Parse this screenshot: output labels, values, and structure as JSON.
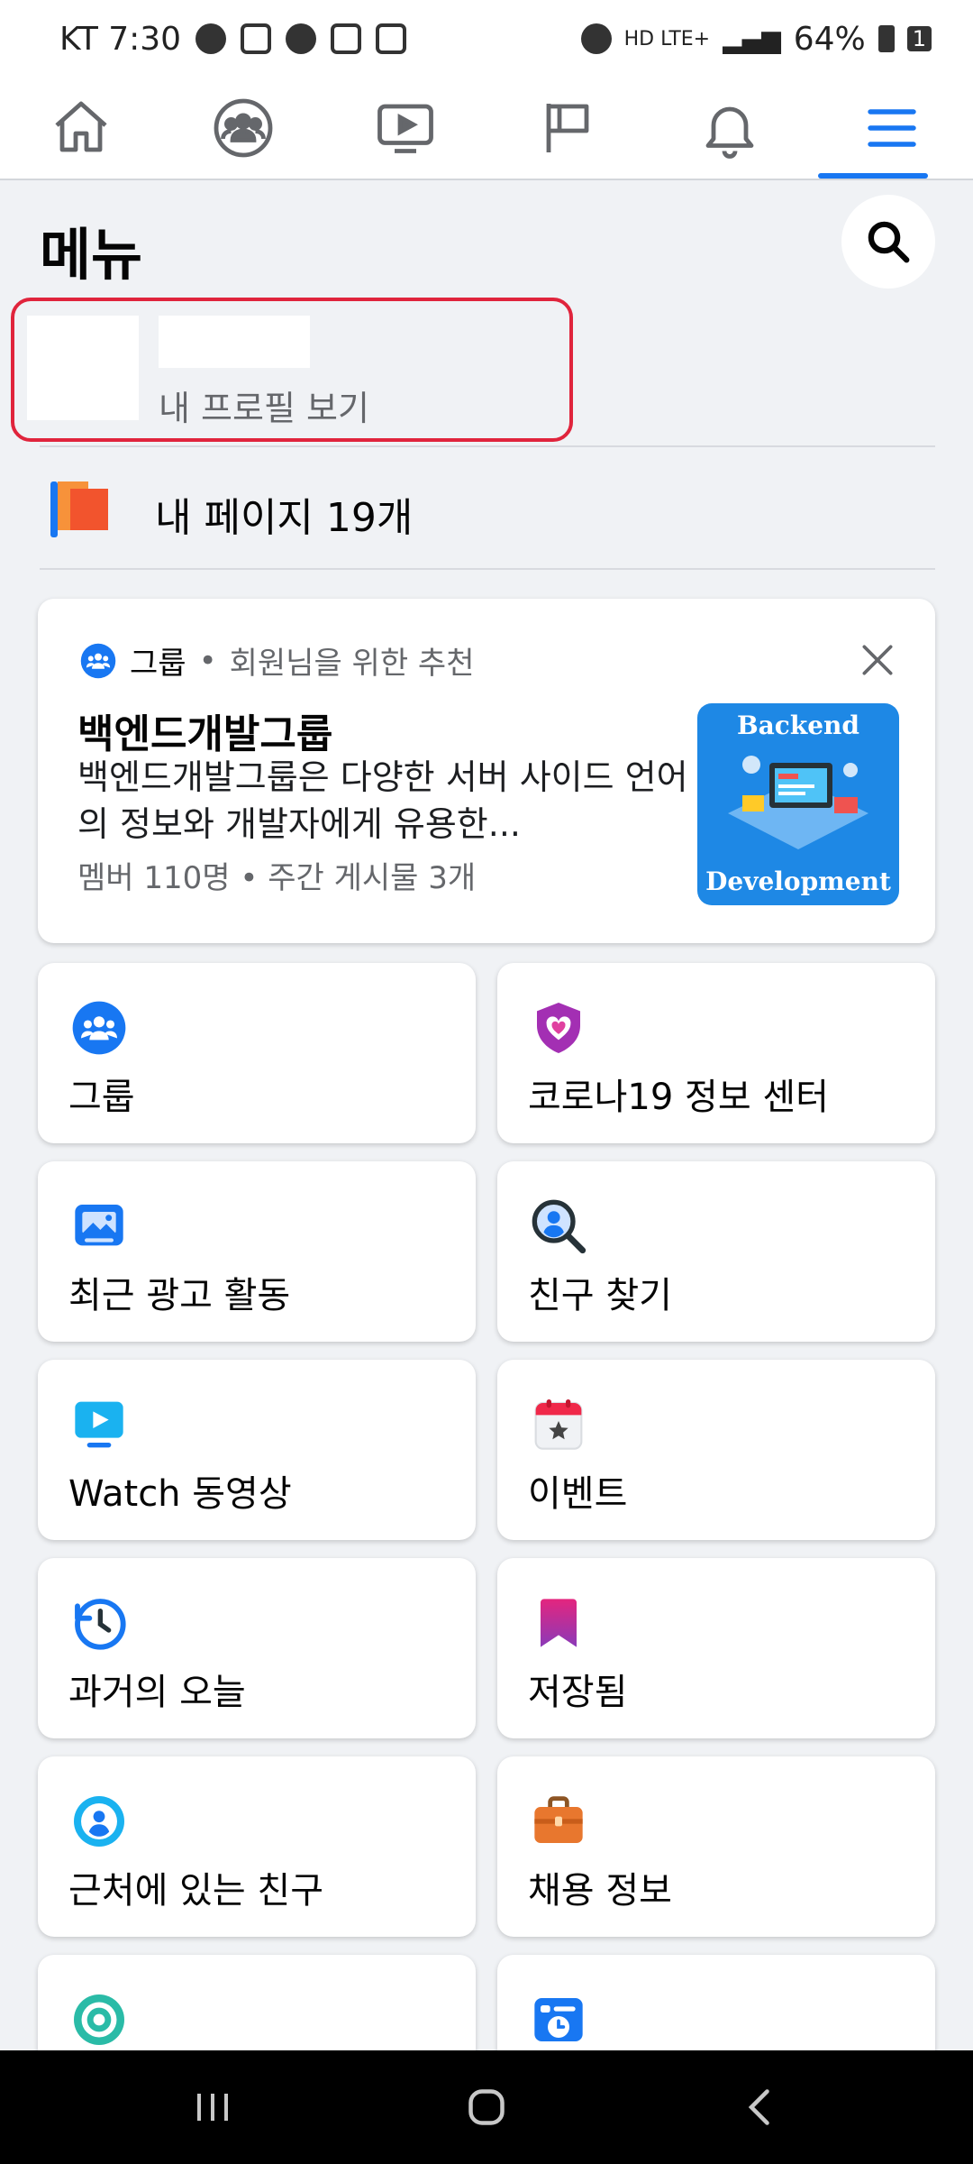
{
  "status_bar": {
    "carrier_time": "KT 7:30",
    "network": "HD LTE+",
    "battery": "64%",
    "sim": "1"
  },
  "nav": {
    "tabs": [
      "home-icon",
      "groups-icon",
      "watch-icon",
      "pages-flag-icon",
      "notifications-bell-icon",
      "menu-hamburger-icon"
    ],
    "active": "menu-hamburger-icon"
  },
  "menu": {
    "title": "메뉴"
  },
  "profile": {
    "link": "내 프로필 보기"
  },
  "pages": {
    "label": "내 페이지 19개"
  },
  "recommendation": {
    "category": "그룹",
    "separator": "•",
    "reason": "회원님을 위한 추천",
    "title": "백엔드개발그룹",
    "description": "백엔드개발그룹은 다양한 서버 사이드 언어의 정보와 개발자에게 유용한...",
    "members": "멤버 110명",
    "posts": "주간 게시물 3개",
    "thumb_top": "Backend",
    "thumb_bottom": "Development"
  },
  "shortcuts": [
    {
      "label": "그룹",
      "icon": "groups-icon"
    },
    {
      "label": "코로나19 정보 센터",
      "icon": "covid-shield-heart-icon"
    },
    {
      "label": "최근 광고 활동",
      "icon": "ad-activity-icon"
    },
    {
      "label": "친구 찾기",
      "icon": "find-friends-icon"
    },
    {
      "label": "Watch 동영상",
      "icon": "watch-video-icon"
    },
    {
      "label": "이벤트",
      "icon": "event-calendar-icon"
    },
    {
      "label": "과거의 오늘",
      "icon": "memories-clock-icon"
    },
    {
      "label": "저장됨",
      "icon": "saved-bookmark-icon"
    },
    {
      "label": "근처에 있는 친구",
      "icon": "nearby-friends-icon"
    },
    {
      "label": "채용 정보",
      "icon": "jobs-briefcase-icon"
    }
  ],
  "colors": {
    "accent": "#1877f2",
    "highlight_border": "#e0243c",
    "background": "#f0f2f5"
  }
}
